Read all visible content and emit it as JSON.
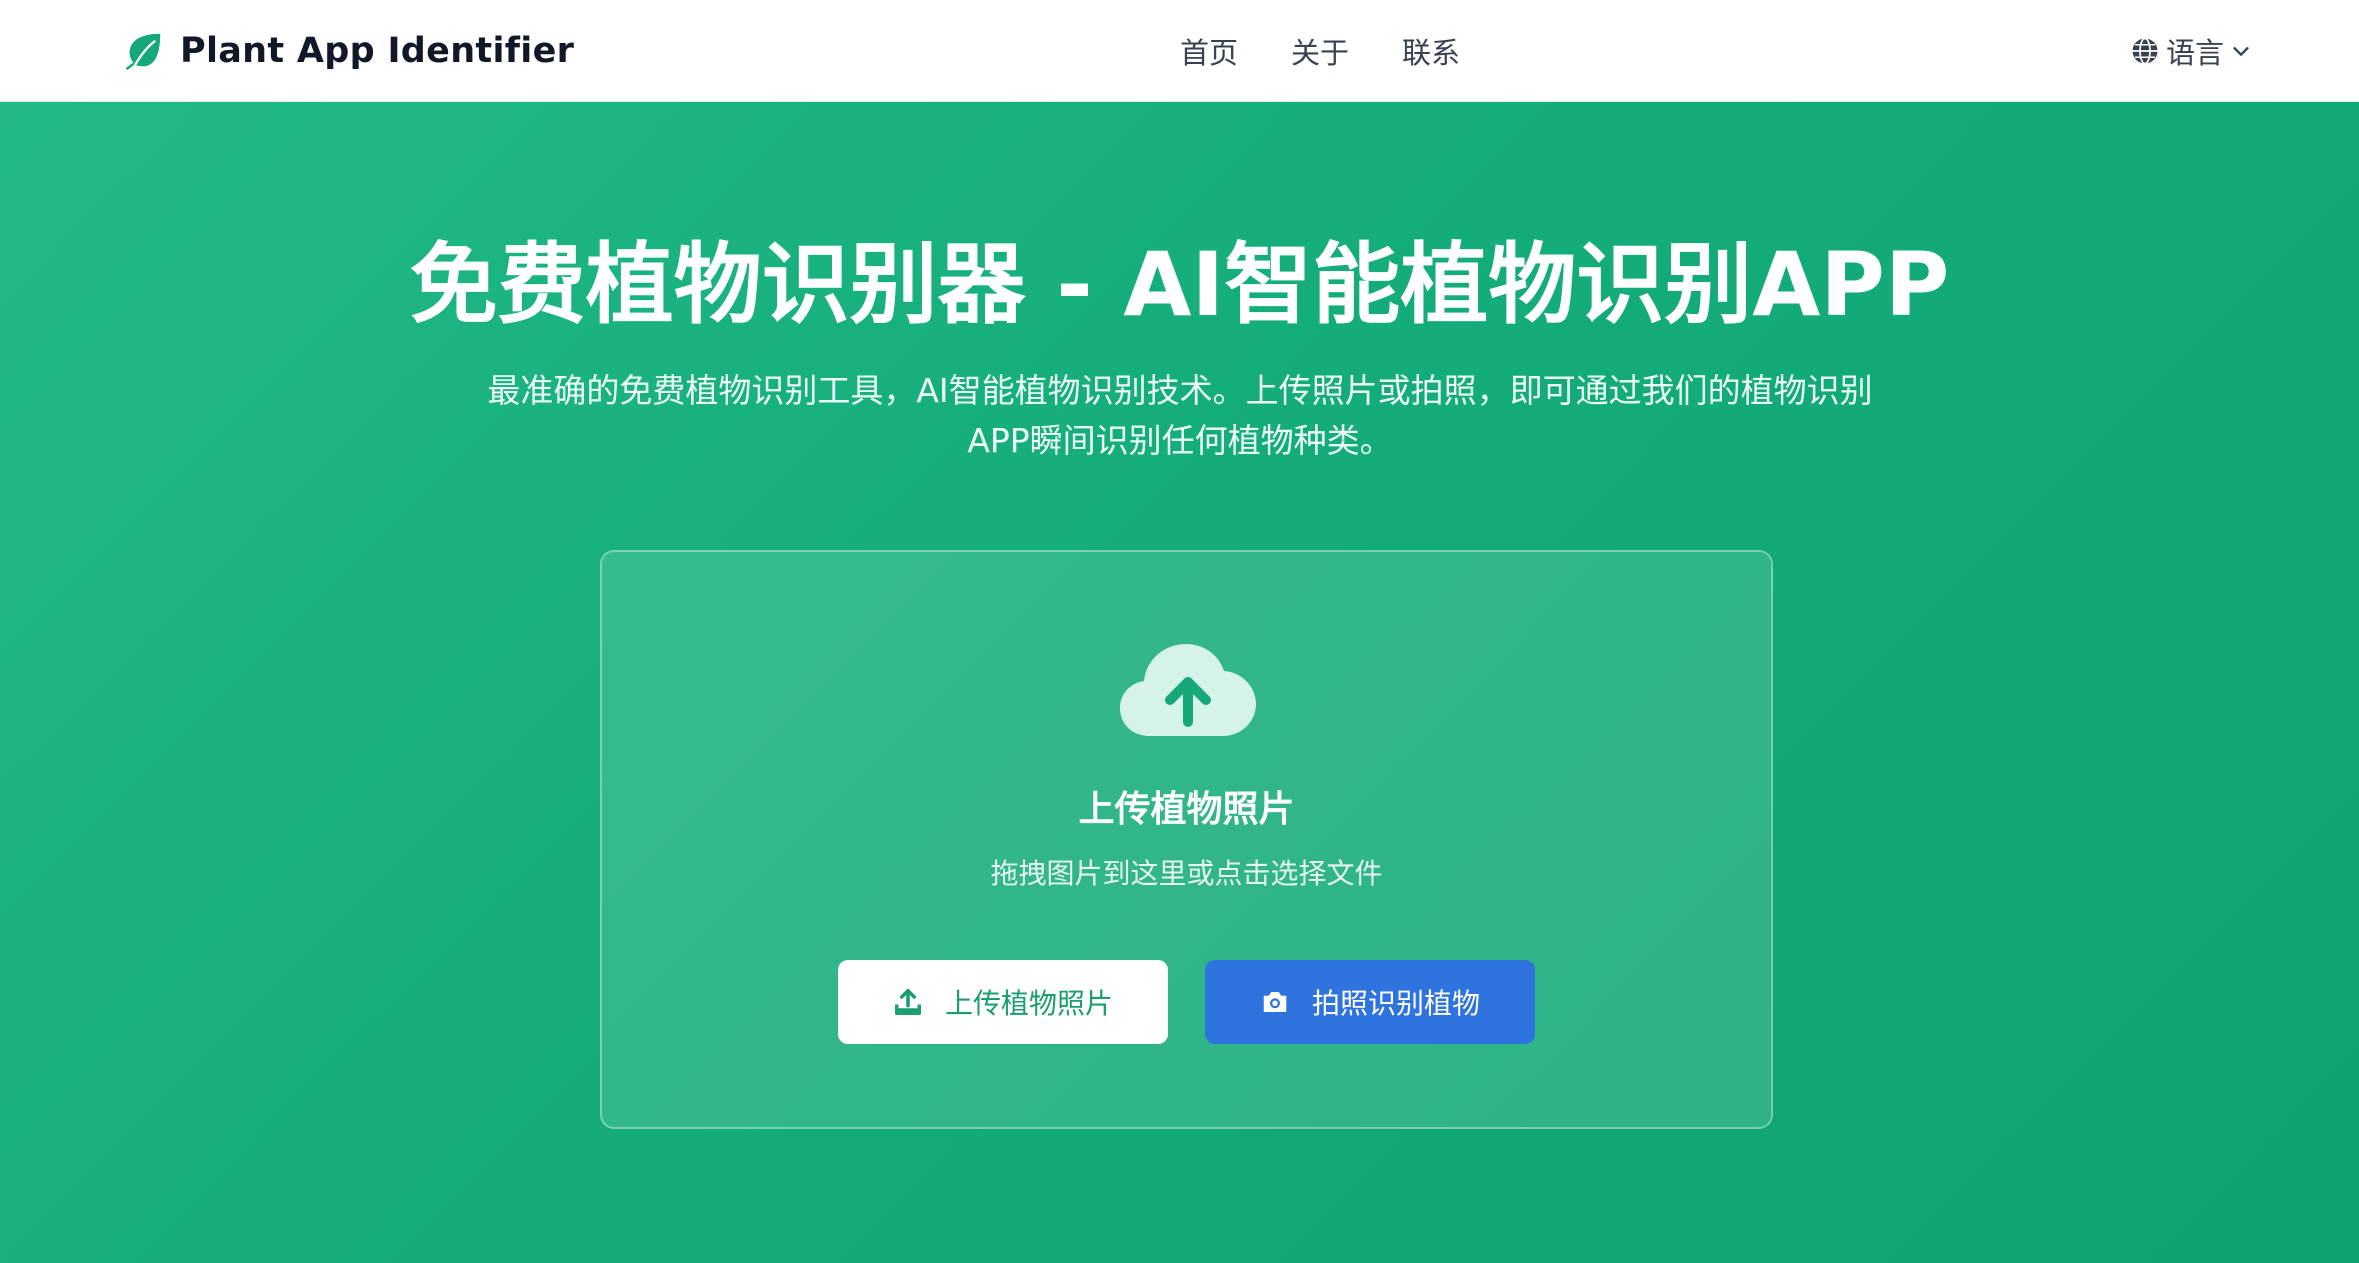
{
  "navbar": {
    "brand": "Plant App Identifier",
    "links": [
      "首页",
      "关于",
      "联系"
    ],
    "language_label": "语言"
  },
  "hero": {
    "title": "免费植物识别器 - AI智能植物识别APP",
    "subtitle_line1": "最准确的免费植物识别工具，AI智能植物识别技术。上传照片或拍照，即可通过我们的植物识别",
    "subtitle_line2": "APP瞬间识别任何植物种类。"
  },
  "upload": {
    "title": "上传植物照片",
    "hint": "拖拽图片到这里或点击选择文件",
    "upload_button": "上传植物照片",
    "camera_button": "拍照识别植物"
  },
  "icons": {
    "brand": "leaf-icon",
    "language": "globe-icon",
    "dropdown": "chevron-down-icon",
    "upload_area": "cloud-upload-icon",
    "upload_button": "upload-icon",
    "camera_button": "camera-icon"
  },
  "colors": {
    "brand_green": "#16a87a",
    "hero_gradient_start": "#21ba87",
    "hero_gradient_end": "#0ea371",
    "camera_button_blue": "#2f74de",
    "upload_button_text": "#1a9e6e"
  }
}
